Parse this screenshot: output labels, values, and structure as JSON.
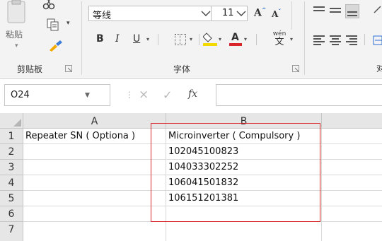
{
  "ribbon": {
    "clipboard": {
      "paste_label": "粘贴",
      "group_label": "剪贴板"
    },
    "font": {
      "font_name": "等线",
      "font_size": "11",
      "grow_label": "A",
      "shrink_label": "A",
      "bold_label": "B",
      "italic_label": "I",
      "underline_label": "U",
      "font_color_label": "A",
      "pinyin_top": "wén",
      "pinyin_bottom": "文",
      "group_label": "字体"
    },
    "colors": {
      "fill_color": "#f2d900",
      "font_color": "#d9262b"
    }
  },
  "formula_bar": {
    "name_box": "O24",
    "cancel_icon": "×",
    "enter_icon": "✓",
    "fx_label": "fx",
    "formula": ""
  },
  "sheet": {
    "columns": [
      "A",
      "B"
    ],
    "rows": [
      {
        "num": "1",
        "a": "Repeater SN ( Optiona )",
        "b": "Microinverter ( Compulsory )"
      },
      {
        "num": "2",
        "a": "",
        "b": "102045100823"
      },
      {
        "num": "3",
        "a": "",
        "b": "104033302252"
      },
      {
        "num": "4",
        "a": "",
        "b": "106041501832"
      },
      {
        "num": "5",
        "a": "",
        "b": "106151201381"
      },
      {
        "num": "6",
        "a": "",
        "b": ""
      },
      {
        "num": "7",
        "a": "",
        "b": ""
      }
    ],
    "highlight_color": "#d9262b"
  }
}
